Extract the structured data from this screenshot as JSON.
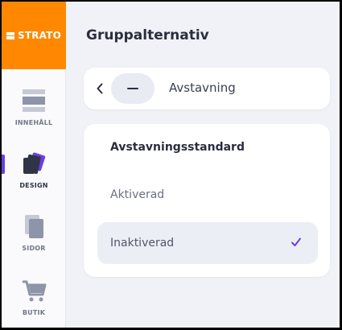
{
  "logo": {
    "text": "STRATO"
  },
  "nav": [
    {
      "id": "content",
      "label": "INNEHÅLL",
      "icon": "content-blocks-icon"
    },
    {
      "id": "design",
      "label": "DESIGN",
      "icon": "design-swatch-icon",
      "active": true
    },
    {
      "id": "pages",
      "label": "SIDOR",
      "icon": "pages-icon"
    },
    {
      "id": "shop",
      "label": "BUTIK",
      "icon": "shopping-cart-icon"
    }
  ],
  "page": {
    "title": "Gruppalternativ"
  },
  "panel_head": {
    "label": "Avstavning",
    "icon": "minus-icon"
  },
  "card": {
    "title": "Avstavningsstandard",
    "options": [
      {
        "label": "Aktiverad",
        "selected": false
      },
      {
        "label": "Inaktiverad",
        "selected": true
      }
    ]
  },
  "colors": {
    "brand": "#ff8800",
    "accent": "#6a3fe0",
    "background": "#f1f2f7"
  }
}
